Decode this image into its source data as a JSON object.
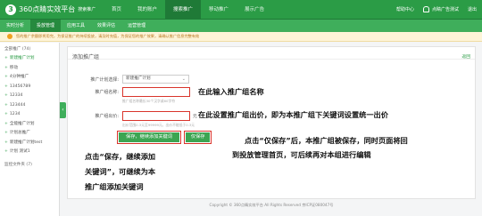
{
  "topbar": {
    "logo_mark": "3",
    "logo_text": "360点睛实效平台",
    "logo_sub": "搜索推广",
    "nav": [
      "首页",
      "我的账户",
      "搜索推广",
      "移动推广",
      "展示广告"
    ],
    "active_index": 2,
    "right": {
      "help": "帮助中心",
      "user": "点睛广告测试",
      "logout": "退出"
    }
  },
  "subbar": {
    "items": [
      "实时分析",
      "投放管理",
      "应用工具",
      "效果评估",
      "运营管理"
    ],
    "active_index": 1
  },
  "notice": {
    "text": "您的推广余额即将用完，为保证推广的持续投放，请及时充值，为保证您的推广效果，请确认推广信息完整有效"
  },
  "sidebar": {
    "header": "全部推广 (74)",
    "items": [
      {
        "label": "新建推广计划",
        "active": true
      },
      {
        "label": "移动",
        "active": false
      },
      {
        "label": "4分钟推广",
        "active": false
      },
      {
        "label": "13456789",
        "active": false
      },
      {
        "label": "12334",
        "active": false
      },
      {
        "label": "123444",
        "active": false
      },
      {
        "label": "1234",
        "active": false
      },
      {
        "label": "全能推广计划",
        "active": false
      },
      {
        "label": "计划总推广",
        "active": false
      },
      {
        "label": "新建推广计划test",
        "active": false
      },
      {
        "label": "计划 测试1",
        "active": false
      }
    ],
    "footer": "监控文件夹 (7)",
    "collapse_icon": "‹"
  },
  "main": {
    "title": "添加推广组",
    "back_link": "返回",
    "plan_label": "推广计划选择:",
    "plan_value": "新建推广计划",
    "group_name_label": "推广组名称:",
    "group_name_value": "",
    "group_name_hint": "推广组名称最长30个汉字或60字符",
    "bid_label": "推广组出价:",
    "bid_value": "",
    "bid_unit": "元",
    "bid_hint": "出价范围0.3元至99999元，出价不能低于0.3元",
    "btn_save_add": "保存，继续添加关键词",
    "btn_save_only": "仅保存"
  },
  "annotations": {
    "name_note": "在此输入推广组名称",
    "bid_note": "在此设置推广组出价，即为本推广组下关键词设置统一出价",
    "save_only_note_1": "点击“仅保存”后，本推广组被保存，同时页面将回",
    "save_only_note_2": "到投放管理首页，可后续再对本组进行编辑",
    "save_add_note_1": "点击“保存，继续添加",
    "save_add_note_2": "关键词”，可继续为本",
    "save_add_note_3": "推广组添加关键词"
  },
  "footer": {
    "text": "Copyright © 360点睛实效平台 All Rights Reserved 京ICP证080047号"
  },
  "colors": {
    "brand_green": "#2b9c46",
    "highlight_red": "#d9342b"
  }
}
